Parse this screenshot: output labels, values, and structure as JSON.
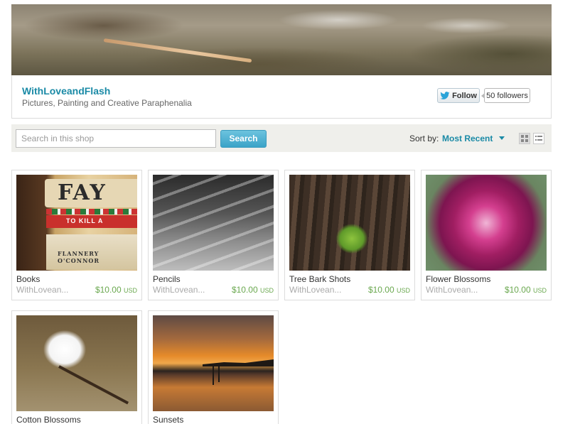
{
  "shop": {
    "name": "WithLoveandFlash",
    "tagline": "Pictures, Painting and Creative Paraphenalia",
    "follow_label": "Follow",
    "followers_label": "50 followers"
  },
  "toolbar": {
    "search_placeholder": "Search in this shop",
    "search_button": "Search",
    "sort_label": "Sort by:",
    "sort_value": "Most Recent"
  },
  "listings": [
    {
      "title": "Books",
      "shop": "WithLovean...",
      "price": "$10.00",
      "currency": "USD"
    },
    {
      "title": "Pencils",
      "shop": "WithLovean...",
      "price": "$10.00",
      "currency": "USD"
    },
    {
      "title": "Tree Bark Shots",
      "shop": "WithLovean...",
      "price": "$10.00",
      "currency": "USD"
    },
    {
      "title": "Flower Blossoms",
      "shop": "WithLovean...",
      "price": "$10.00",
      "currency": "USD"
    },
    {
      "title": "Cotton Blossoms"
    },
    {
      "title": "Sunsets"
    }
  ],
  "book_thumb": {
    "spine_top": "FAY",
    "spine_middle": "TO KILL A",
    "spine_bottom": "FLANNERY O'CONNOR"
  },
  "colors": {
    "accent": "#1a8aa6",
    "price": "#6aa84f",
    "search_button": "#3ba3c8"
  },
  "icons": {
    "follow": "twitter-bird-icon",
    "grid_view": "grid-view-icon",
    "list_view": "list-view-icon"
  }
}
